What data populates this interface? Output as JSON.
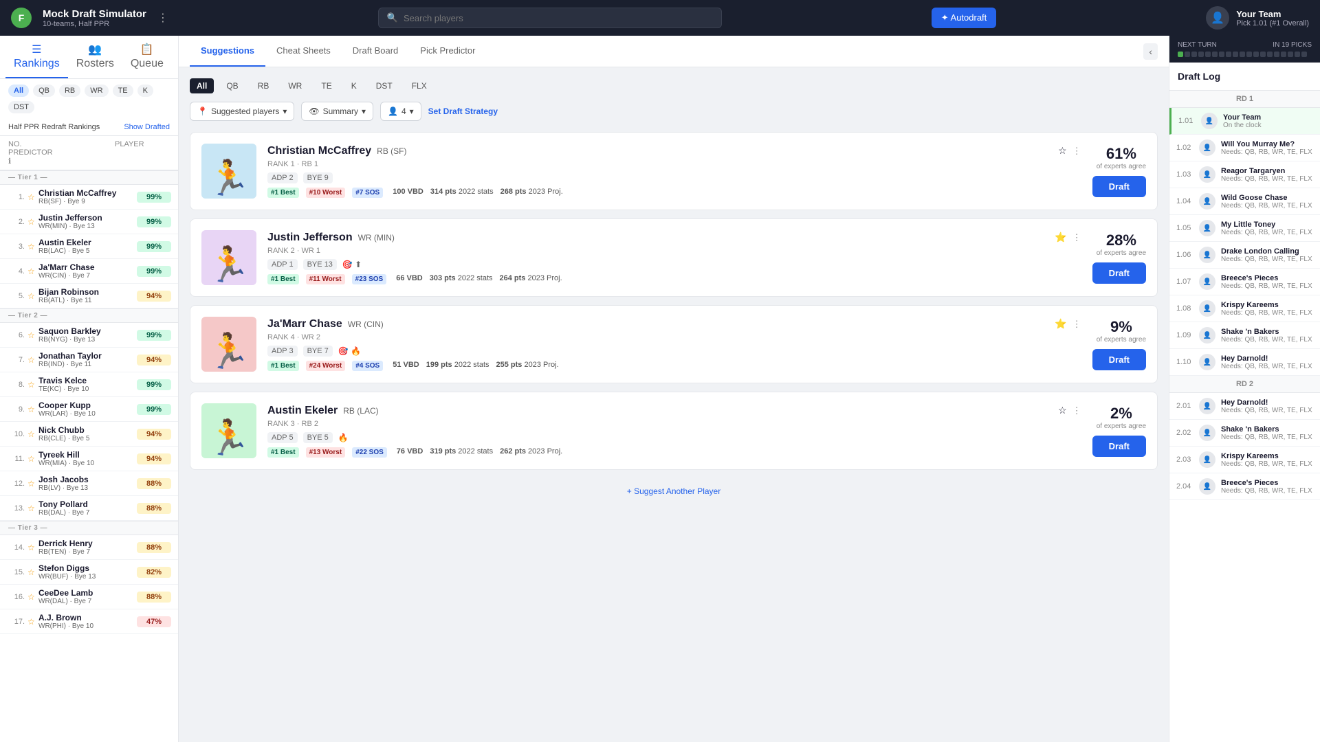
{
  "app": {
    "logo": "F",
    "title": "Mock Draft Simulator",
    "subtitle": "10-teams, Half PPR",
    "search_placeholder": "Search players",
    "autodraft_label": "✦ Autodraft",
    "your_team": {
      "name": "Your Team",
      "pick": "Pick 1.01 (#1 Overall)"
    }
  },
  "header": {
    "menu_icon": "⋮"
  },
  "sidebar": {
    "nav": [
      {
        "id": "rankings",
        "icon": "☰",
        "label": "Rankings",
        "active": true
      },
      {
        "id": "rosters",
        "icon": "👥",
        "label": "Rosters",
        "active": false
      },
      {
        "id": "queue",
        "icon": "📋",
        "label": "Queue",
        "active": false
      }
    ],
    "position_filters": [
      "All",
      "QB",
      "RB",
      "WR",
      "TE",
      "K",
      "DST"
    ],
    "active_filter": "All",
    "rankings_label": "Half PPR Redraft Rankings",
    "show_drafted": "Show Drafted",
    "columns": {
      "no": "NO.",
      "player": "PLAYER",
      "predictor": "PREDICTOR ℹ"
    },
    "tiers": [
      {
        "label": "Tier 1",
        "players": [
          {
            "num": "1.",
            "name": "Christian McCaffrey",
            "pos": "RB(SF) · Bye 9",
            "predictor": "99%",
            "badge": "green",
            "icons": [
              "⭐",
              ""
            ]
          },
          {
            "num": "2.",
            "name": "Justin Jefferson",
            "pos": "WR(MIN) · Bye 13",
            "predictor": "99%",
            "badge": "green",
            "icons": [
              "⭐",
              "🎯",
              "⬆"
            ]
          },
          {
            "num": "3.",
            "name": "Austin Ekeler",
            "pos": "RB(LAC) · Bye 5",
            "predictor": "99%",
            "badge": "green",
            "icons": [
              "⭐",
              "🔥"
            ]
          },
          {
            "num": "4.",
            "name": "Ja'Marr Chase",
            "pos": "WR(CIN) · Bye 7",
            "predictor": "99%",
            "badge": "green",
            "icons": [
              "⭐",
              "🎯"
            ]
          },
          {
            "num": "5.",
            "name": "Bijan Robinson",
            "pos": "RB(ATL) · Bye 11",
            "predictor": "94%",
            "badge": "yellow",
            "icons": [
              "🔵",
              "🆕"
            ]
          }
        ]
      },
      {
        "label": "Tier 2",
        "players": [
          {
            "num": "6.",
            "name": "Saquon Barkley",
            "pos": "RB(NYG) · Bye 13",
            "predictor": "99%",
            "badge": "green",
            "icons": [
              "⬆",
              "🎯"
            ]
          },
          {
            "num": "7.",
            "name": "Jonathan Taylor",
            "pos": "RB(IND) · Bye 11",
            "predictor": "94%",
            "badge": "yellow",
            "icons": [
              "❄",
              "🔴"
            ]
          },
          {
            "num": "8.",
            "name": "Travis Kelce",
            "pos": "TE(KC) · Bye 10",
            "predictor": "99%",
            "badge": "green",
            "icons": [
              "🔥"
            ]
          },
          {
            "num": "9.",
            "name": "Cooper Kupp",
            "pos": "WR(LAR) · Bye 10",
            "predictor": "99%",
            "badge": "green",
            "icons": []
          },
          {
            "num": "10.",
            "name": "Nick Chubb",
            "pos": "RB(CLE) · Bye 5",
            "predictor": "94%",
            "badge": "yellow",
            "icons": [
              "🚫"
            ]
          },
          {
            "num": "11.",
            "name": "Tyreek Hill",
            "pos": "WR(MIA) · Bye 10",
            "predictor": "94%",
            "badge": "yellow",
            "icons": [
              "🔥",
              "🎯"
            ]
          },
          {
            "num": "12.",
            "name": "Josh Jacobs",
            "pos": "RB(LV) · Bye 13",
            "predictor": "88%",
            "badge": "yellow",
            "icons": []
          },
          {
            "num": "13.",
            "name": "Tony Pollard",
            "pos": "RB(DAL) · Bye 7",
            "predictor": "88%",
            "badge": "yellow",
            "icons": [
              "⬆",
              "⬆"
            ]
          }
        ]
      },
      {
        "label": "Tier 3",
        "players": [
          {
            "num": "14.",
            "name": "Derrick Henry",
            "pos": "RB(TEN) · Bye 7",
            "predictor": "88%",
            "badge": "yellow",
            "icons": [
              "❄"
            ]
          },
          {
            "num": "15.",
            "name": "Stefon Diggs",
            "pos": "WR(BUF) · Bye 13",
            "predictor": "82%",
            "badge": "yellow",
            "icons": []
          },
          {
            "num": "16.",
            "name": "CeeDee Lamb",
            "pos": "WR(DAL) · Bye 7",
            "predictor": "88%",
            "badge": "yellow",
            "icons": [
              "⬆"
            ]
          },
          {
            "num": "17.",
            "name": "A.J. Brown",
            "pos": "WR(PHI) · Bye 10",
            "predictor": "47%",
            "badge": "red",
            "icons": [
              "🔥"
            ]
          }
        ]
      }
    ]
  },
  "main_tabs": [
    "Suggestions",
    "Cheat Sheets",
    "Draft Board",
    "Pick Predictor"
  ],
  "active_tab": "Suggestions",
  "position_tabs": [
    "All",
    "QB",
    "RB",
    "WR",
    "TE",
    "K",
    "DST",
    "FLX"
  ],
  "active_pos": "All",
  "filters": {
    "suggested_players": "Suggested players",
    "summary": "Summary",
    "count": "4",
    "set_strategy": "Set Draft Strategy"
  },
  "player_cards": [
    {
      "name": "Christian McCaffrey",
      "pos": "RB (SF)",
      "rank_label": "RANK 1 · RB 1",
      "adp": "ADP 2",
      "bye": "BYE 9",
      "badges": [
        "#1 Best",
        "#10 Worst",
        "#7 SOS"
      ],
      "vbd": "100 VBD",
      "stats_2022": "314 pts",
      "proj_2023": "268 pts",
      "expert_pct": "61%",
      "expert_label": "of experts agree",
      "draft_label": "Draft",
      "icons": [
        "🌟",
        "⋮"
      ],
      "color": "#c8d6e5",
      "emoji": "🏈"
    },
    {
      "name": "Justin Jefferson",
      "pos": "WR (MIN)",
      "rank_label": "RANK 2 · WR 1",
      "adp": "ADP 1",
      "bye": "BYE 13",
      "badges": [
        "#1 Best",
        "#11 Worst",
        "#23 SOS"
      ],
      "vbd": "66 VBD",
      "stats_2022": "303 pts",
      "proj_2023": "264 pts",
      "expert_pct": "28%",
      "expert_label": "of experts agree",
      "draft_label": "Draft",
      "icons": [
        "⭐",
        "⋮"
      ],
      "color": "#c8d6e5",
      "emoji": "🏈"
    },
    {
      "name": "Ja'Marr Chase",
      "pos": "WR (CIN)",
      "rank_label": "RANK 4 · WR 2",
      "adp": "ADP 3",
      "bye": "BYE 7",
      "badges": [
        "#1 Best",
        "#24 Worst",
        "#4 SOS"
      ],
      "vbd": "51 VBD",
      "stats_2022": "199 pts",
      "proj_2023": "255 pts",
      "expert_pct": "9%",
      "expert_label": "of experts agree",
      "draft_label": "Draft",
      "icons": [
        "⭐",
        "⋮"
      ],
      "color": "#c8d6e5",
      "emoji": "🏈"
    },
    {
      "name": "Austin Ekeler",
      "pos": "RB (LAC)",
      "rank_label": "RANK 3 · RB 2",
      "adp": "ADP 5",
      "bye": "BYE 5",
      "badges": [
        "#1 Best",
        "#13 Worst",
        "#22 SOS"
      ],
      "vbd": "76 VBD",
      "stats_2022": "319 pts",
      "proj_2023": "262 pts",
      "expert_pct": "2%",
      "expert_label": "of experts agree",
      "draft_label": "Draft",
      "icons": [
        "🌟",
        "⋮"
      ],
      "color": "#c8d6e5",
      "emoji": "🏈"
    }
  ],
  "suggest_another": "+ Suggest Another Player",
  "right_panel": {
    "next_turn_label": "NEXT TURN",
    "in_picks": "IN 19 PICKS",
    "draft_log_title": "Draft Log",
    "rounds": [
      {
        "label": "RD 1",
        "picks": [
          {
            "num": "1.01",
            "team": "Your Team",
            "needs": "On the clock",
            "on_clock": true
          },
          {
            "num": "1.02",
            "team": "Will You Murray Me?",
            "needs": "Needs: QB, RB, WR, TE, FLX",
            "on_clock": false
          },
          {
            "num": "1.03",
            "team": "Reagor Targaryen",
            "needs": "Needs: QB, RB, WR, TE, FLX",
            "on_clock": false
          },
          {
            "num": "1.04",
            "team": "Wild Goose Chase",
            "needs": "Needs: QB, RB, WR, TE, FLX",
            "on_clock": false
          },
          {
            "num": "1.05",
            "team": "My Little Toney",
            "needs": "Needs: QB, RB, WR, TE, FLX",
            "on_clock": false
          },
          {
            "num": "1.06",
            "team": "Drake London Calling",
            "needs": "Needs: QB, RB, WR, TE, FLX",
            "on_clock": false
          },
          {
            "num": "1.07",
            "team": "Breece's Pieces",
            "needs": "Needs: QB, RB, WR, TE, FLX",
            "on_clock": false
          },
          {
            "num": "1.08",
            "team": "Krispy Kareems",
            "needs": "Needs: QB, RB, WR, TE, FLX",
            "on_clock": false
          },
          {
            "num": "1.09",
            "team": "Shake 'n Bakers",
            "needs": "Needs: QB, RB, WR, TE, FLX",
            "on_clock": false
          },
          {
            "num": "1.10",
            "team": "Hey Darnold!",
            "needs": "Needs: QB, RB, WR, TE, FLX",
            "on_clock": false
          }
        ]
      },
      {
        "label": "RD 2",
        "picks": [
          {
            "num": "2.01",
            "team": "Hey Darnold!",
            "needs": "Needs: QB, RB, WR, TE, FLX",
            "on_clock": false
          },
          {
            "num": "2.02",
            "team": "Shake 'n Bakers",
            "needs": "Needs: QB, RB, WR, TE, FLX",
            "on_clock": false
          },
          {
            "num": "2.03",
            "team": "Krispy Kareems",
            "needs": "Needs: QB, RB, WR, TE, FLX",
            "on_clock": false
          },
          {
            "num": "2.04",
            "team": "Breece's Pieces",
            "needs": "Needs: QB, RB, WR, TE, FLX",
            "on_clock": false
          }
        ]
      }
    ]
  }
}
